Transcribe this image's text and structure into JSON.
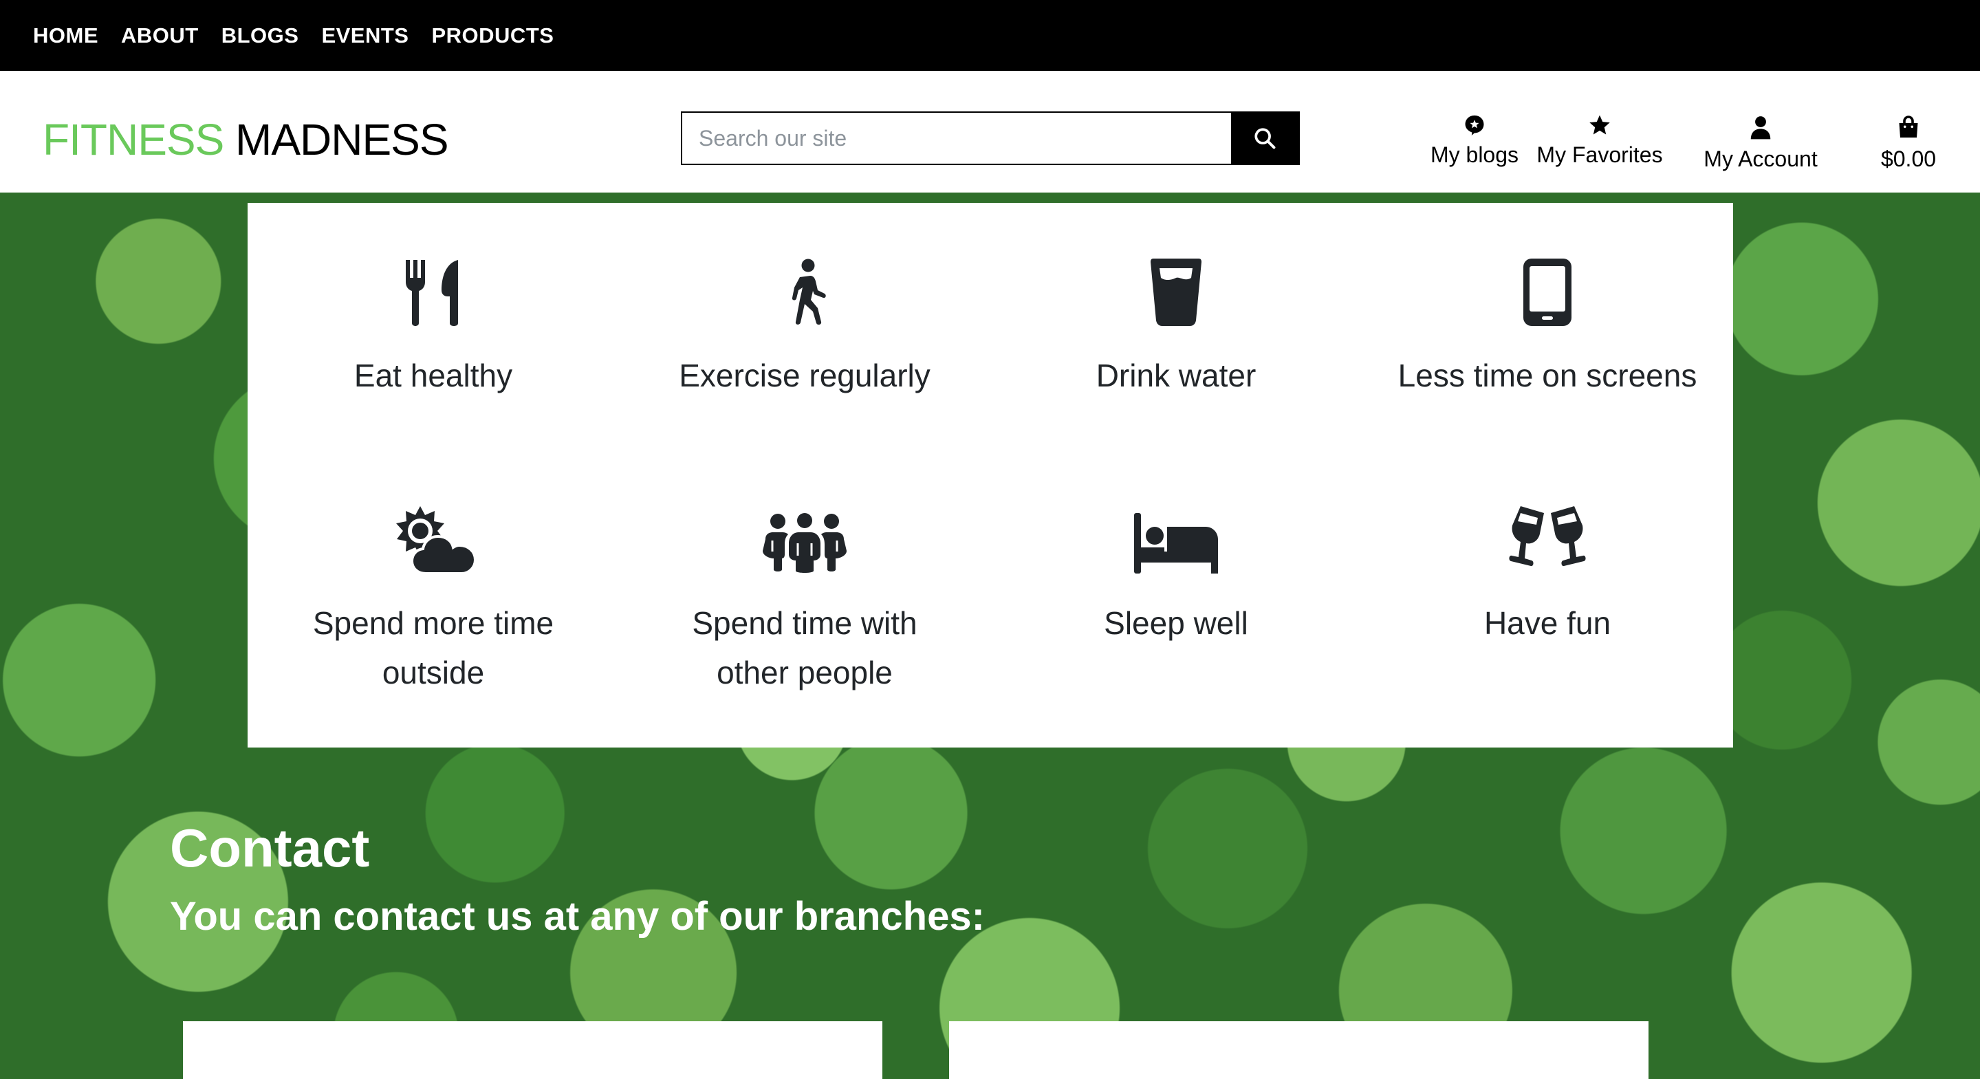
{
  "topnav": {
    "items": [
      "HOME",
      "ABOUT",
      "BLOGS",
      "EVENTS",
      "PRODUCTS"
    ]
  },
  "header": {
    "logo_part1": "FITNESS",
    "logo_part2": "MADNESS",
    "logo_colors": {
      "part1": "#6ac95b",
      "part2": "#000000"
    },
    "search": {
      "placeholder": "Search our site",
      "value": ""
    },
    "icons": {
      "blogs": {
        "label": "My blogs",
        "icon": "blog-badge-icon"
      },
      "favorites": {
        "label": "My Favorites",
        "icon": "star-icon"
      },
      "account": {
        "label": "My Account",
        "icon": "user-icon"
      },
      "cart": {
        "label": "$0.00",
        "icon": "shopping-bag-icon"
      }
    }
  },
  "features": [
    {
      "label": "Eat healthy",
      "icon": "utensils-icon"
    },
    {
      "label": "Exercise regularly",
      "icon": "walking-icon"
    },
    {
      "label": "Drink water",
      "icon": "glass-water-icon"
    },
    {
      "label": "Less time on screens",
      "icon": "mobile-phone-icon"
    },
    {
      "label": "Spend more time outside",
      "icon": "sun-cloud-icon"
    },
    {
      "label": "Spend time with other people",
      "icon": "people-group-icon"
    },
    {
      "label": "Sleep well",
      "icon": "bed-icon"
    },
    {
      "label": "Have fun",
      "icon": "cheers-glasses-icon"
    }
  ],
  "contact": {
    "title": "Contact",
    "subtitle": "You can contact us at any of our branches:"
  },
  "colors": {
    "nav_bg": "#000000",
    "accent": "#6ac95b",
    "icon": "#212529"
  }
}
